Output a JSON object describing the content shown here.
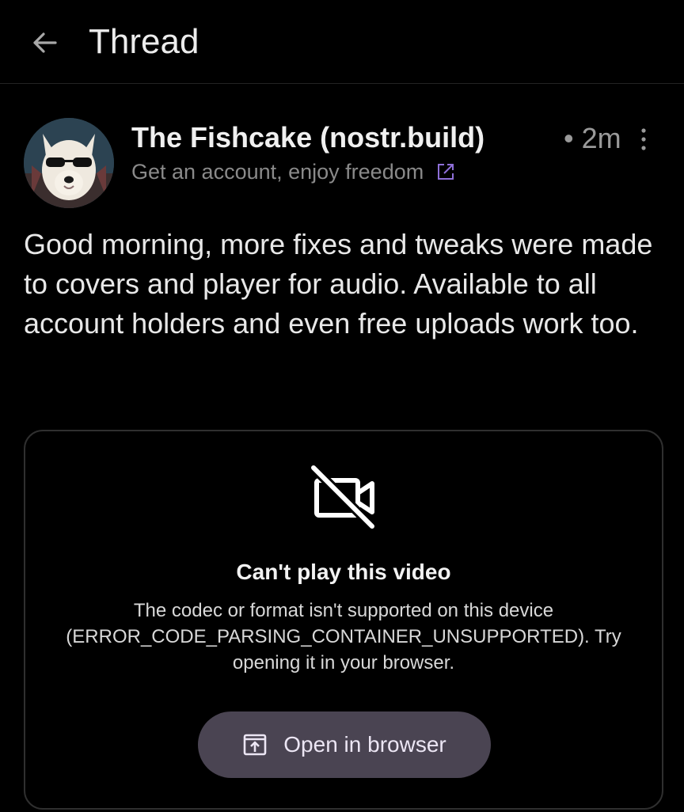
{
  "header": {
    "title": "Thread",
    "back_icon": "arrow-left-icon"
  },
  "post": {
    "author_name": "The Fishcake (nostr.build)",
    "nip05": "Get an account, enjoy freedom",
    "nip05_icon": "external-link-icon",
    "time": "• 2m",
    "more_icon": "more-vertical-icon",
    "avatar_icon": "dog-sunglasses-avatar",
    "content": "Good morning, more fixes and tweaks were made to covers and player for audio. Available to all account holders and even free uploads work too."
  },
  "video": {
    "icon": "video-off-icon",
    "error_title": "Can't play this video",
    "error_message": "The codec or format isn't supported on this device (ERROR_CODE_PARSING_CONTAINER_UNSUPPORTED). Try opening it in your browser.",
    "button_label": "Open in browser",
    "button_icon": "open-in-browser-icon"
  },
  "colors": {
    "background": "#000000",
    "accent": "#4a4452",
    "link_icon": "#8e6fd8"
  }
}
